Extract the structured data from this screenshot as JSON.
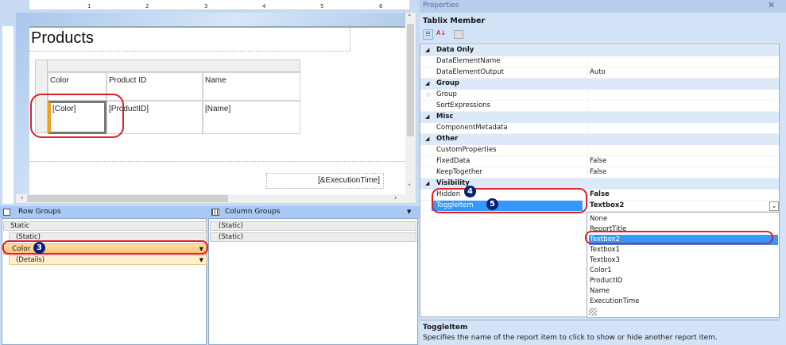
{
  "designer": {
    "ruler_marks": [
      "1",
      "2",
      "3",
      "4",
      "5",
      "6"
    ],
    "report_title": "Products",
    "table": {
      "headers": [
        "Color",
        "Product ID",
        "Name"
      ],
      "details": [
        "[Color]",
        "[ProductID]",
        "[Name]"
      ]
    },
    "footer_expression": "[&ExecutionTime]"
  },
  "row_groups": {
    "title": "Row Groups",
    "items": [
      "Static",
      "(Static)",
      "Color",
      "(Details)"
    ]
  },
  "column_groups": {
    "title": "Column Groups",
    "items": [
      "(Static)",
      "(Static)"
    ]
  },
  "properties": {
    "title": "Properties",
    "object": "Tablix Member",
    "rows": [
      {
        "type": "cat",
        "name": "Data Only"
      },
      {
        "type": "prop",
        "name": "DataElementName",
        "value": ""
      },
      {
        "type": "prop",
        "name": "DataElementOutput",
        "value": "Auto"
      },
      {
        "type": "cat",
        "name": "Group"
      },
      {
        "type": "prop",
        "name": "Group",
        "value": ""
      },
      {
        "type": "prop",
        "name": "SortExpressions",
        "value": ""
      },
      {
        "type": "cat",
        "name": "Misc"
      },
      {
        "type": "prop",
        "name": "ComponentMetadata",
        "value": ""
      },
      {
        "type": "cat",
        "name": "Other"
      },
      {
        "type": "prop",
        "name": "CustomProperties",
        "value": ""
      },
      {
        "type": "prop",
        "name": "FixedData",
        "value": "False"
      },
      {
        "type": "prop",
        "name": "KeepTogether",
        "value": "False"
      },
      {
        "type": "cat",
        "name": "Visibility"
      },
      {
        "type": "prop",
        "name": "Hidden",
        "value": "False"
      },
      {
        "type": "prop",
        "name": "ToggleItem",
        "value": "Textbox2"
      }
    ],
    "dropdown_options": [
      "None",
      "ReportTitle",
      "Textbox2",
      "Textbox1",
      "Textbox3",
      "Color1",
      "ProductID",
      "Name",
      "ExecutionTime"
    ],
    "dropdown_selected": "Textbox2",
    "description_title": "ToggleItem",
    "description_text": "Specifies the name of the report item to click to show or hide another report item."
  },
  "badges": [
    "3",
    "4",
    "5"
  ],
  "colors": {
    "selection": "#3399ff",
    "highlight": "#e2202a",
    "group_selected": "#ffc77a",
    "badge": "#0b1f74"
  }
}
